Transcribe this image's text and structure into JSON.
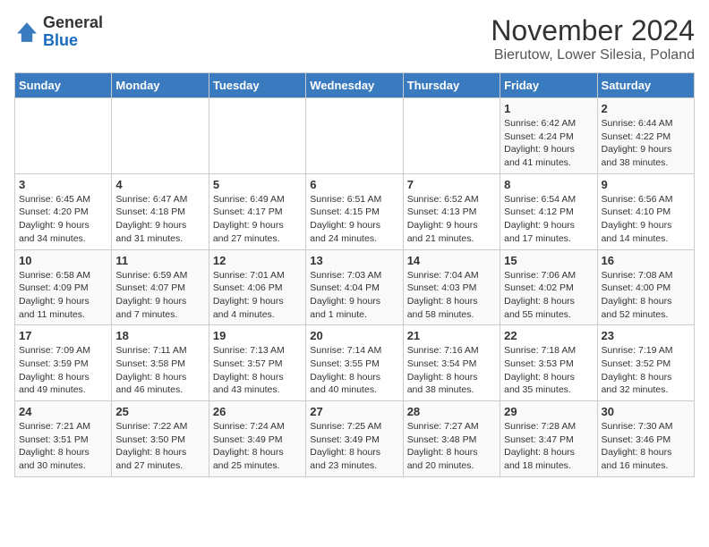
{
  "header": {
    "logo_general": "General",
    "logo_blue": "Blue",
    "main_title": "November 2024",
    "subtitle": "Bierutow, Lower Silesia, Poland"
  },
  "calendar": {
    "days_of_week": [
      "Sunday",
      "Monday",
      "Tuesday",
      "Wednesday",
      "Thursday",
      "Friday",
      "Saturday"
    ],
    "weeks": [
      [
        {
          "day": "",
          "info": ""
        },
        {
          "day": "",
          "info": ""
        },
        {
          "day": "",
          "info": ""
        },
        {
          "day": "",
          "info": ""
        },
        {
          "day": "",
          "info": ""
        },
        {
          "day": "1",
          "info": "Sunrise: 6:42 AM\nSunset: 4:24 PM\nDaylight: 9 hours\nand 41 minutes."
        },
        {
          "day": "2",
          "info": "Sunrise: 6:44 AM\nSunset: 4:22 PM\nDaylight: 9 hours\nand 38 minutes."
        }
      ],
      [
        {
          "day": "3",
          "info": "Sunrise: 6:45 AM\nSunset: 4:20 PM\nDaylight: 9 hours\nand 34 minutes."
        },
        {
          "day": "4",
          "info": "Sunrise: 6:47 AM\nSunset: 4:18 PM\nDaylight: 9 hours\nand 31 minutes."
        },
        {
          "day": "5",
          "info": "Sunrise: 6:49 AM\nSunset: 4:17 PM\nDaylight: 9 hours\nand 27 minutes."
        },
        {
          "day": "6",
          "info": "Sunrise: 6:51 AM\nSunset: 4:15 PM\nDaylight: 9 hours\nand 24 minutes."
        },
        {
          "day": "7",
          "info": "Sunrise: 6:52 AM\nSunset: 4:13 PM\nDaylight: 9 hours\nand 21 minutes."
        },
        {
          "day": "8",
          "info": "Sunrise: 6:54 AM\nSunset: 4:12 PM\nDaylight: 9 hours\nand 17 minutes."
        },
        {
          "day": "9",
          "info": "Sunrise: 6:56 AM\nSunset: 4:10 PM\nDaylight: 9 hours\nand 14 minutes."
        }
      ],
      [
        {
          "day": "10",
          "info": "Sunrise: 6:58 AM\nSunset: 4:09 PM\nDaylight: 9 hours\nand 11 minutes."
        },
        {
          "day": "11",
          "info": "Sunrise: 6:59 AM\nSunset: 4:07 PM\nDaylight: 9 hours\nand 7 minutes."
        },
        {
          "day": "12",
          "info": "Sunrise: 7:01 AM\nSunset: 4:06 PM\nDaylight: 9 hours\nand 4 minutes."
        },
        {
          "day": "13",
          "info": "Sunrise: 7:03 AM\nSunset: 4:04 PM\nDaylight: 9 hours\nand 1 minute."
        },
        {
          "day": "14",
          "info": "Sunrise: 7:04 AM\nSunset: 4:03 PM\nDaylight: 8 hours\nand 58 minutes."
        },
        {
          "day": "15",
          "info": "Sunrise: 7:06 AM\nSunset: 4:02 PM\nDaylight: 8 hours\nand 55 minutes."
        },
        {
          "day": "16",
          "info": "Sunrise: 7:08 AM\nSunset: 4:00 PM\nDaylight: 8 hours\nand 52 minutes."
        }
      ],
      [
        {
          "day": "17",
          "info": "Sunrise: 7:09 AM\nSunset: 3:59 PM\nDaylight: 8 hours\nand 49 minutes."
        },
        {
          "day": "18",
          "info": "Sunrise: 7:11 AM\nSunset: 3:58 PM\nDaylight: 8 hours\nand 46 minutes."
        },
        {
          "day": "19",
          "info": "Sunrise: 7:13 AM\nSunset: 3:57 PM\nDaylight: 8 hours\nand 43 minutes."
        },
        {
          "day": "20",
          "info": "Sunrise: 7:14 AM\nSunset: 3:55 PM\nDaylight: 8 hours\nand 40 minutes."
        },
        {
          "day": "21",
          "info": "Sunrise: 7:16 AM\nSunset: 3:54 PM\nDaylight: 8 hours\nand 38 minutes."
        },
        {
          "day": "22",
          "info": "Sunrise: 7:18 AM\nSunset: 3:53 PM\nDaylight: 8 hours\nand 35 minutes."
        },
        {
          "day": "23",
          "info": "Sunrise: 7:19 AM\nSunset: 3:52 PM\nDaylight: 8 hours\nand 32 minutes."
        }
      ],
      [
        {
          "day": "24",
          "info": "Sunrise: 7:21 AM\nSunset: 3:51 PM\nDaylight: 8 hours\nand 30 minutes."
        },
        {
          "day": "25",
          "info": "Sunrise: 7:22 AM\nSunset: 3:50 PM\nDaylight: 8 hours\nand 27 minutes."
        },
        {
          "day": "26",
          "info": "Sunrise: 7:24 AM\nSunset: 3:49 PM\nDaylight: 8 hours\nand 25 minutes."
        },
        {
          "day": "27",
          "info": "Sunrise: 7:25 AM\nSunset: 3:49 PM\nDaylight: 8 hours\nand 23 minutes."
        },
        {
          "day": "28",
          "info": "Sunrise: 7:27 AM\nSunset: 3:48 PM\nDaylight: 8 hours\nand 20 minutes."
        },
        {
          "day": "29",
          "info": "Sunrise: 7:28 AM\nSunset: 3:47 PM\nDaylight: 8 hours\nand 18 minutes."
        },
        {
          "day": "30",
          "info": "Sunrise: 7:30 AM\nSunset: 3:46 PM\nDaylight: 8 hours\nand 16 minutes."
        }
      ]
    ]
  }
}
